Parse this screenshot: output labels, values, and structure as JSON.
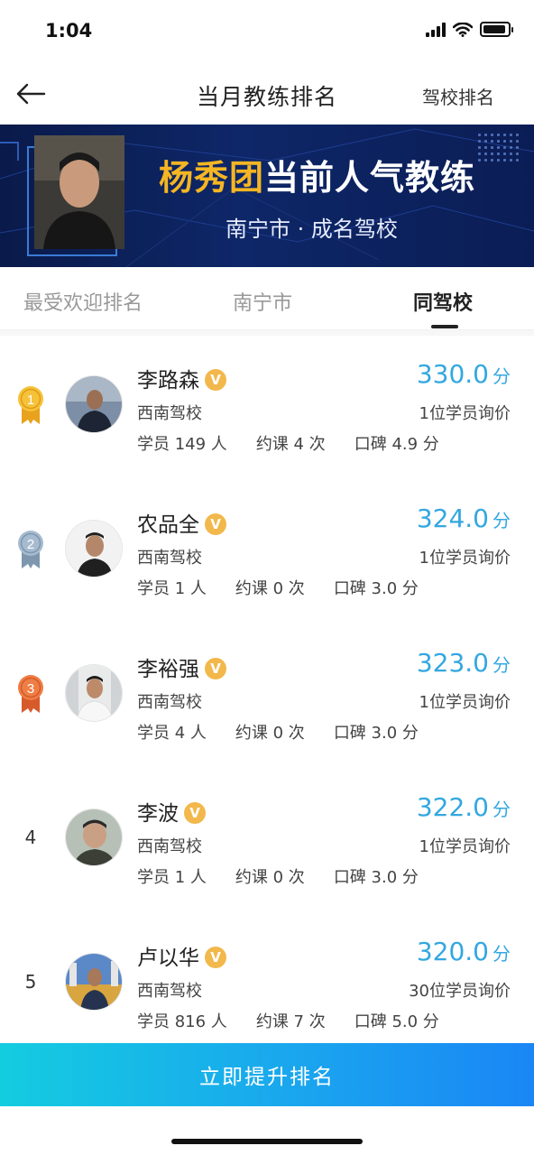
{
  "status": {
    "time": "1:04"
  },
  "nav": {
    "title": "当月教练排名",
    "right_label": "驾校排名",
    "back_icon": "arrow-left-icon"
  },
  "banner": {
    "name": "杨秀团",
    "title_suffix": "当前人气教练",
    "subtitle": "南宁市 · 成名驾校"
  },
  "tabs": [
    {
      "label": "最受欢迎排名",
      "active": false
    },
    {
      "label": "南宁市",
      "active": false
    },
    {
      "label": "同驾校",
      "active": true
    }
  ],
  "coaches": [
    {
      "rank": "1",
      "name": "李路森",
      "school": "西南驾校",
      "score": "330.0",
      "unit": "分",
      "inquiry": "1位学员询价",
      "students": "学员 149 人",
      "lessons": "约课 4 次",
      "rating": "口碑 4.9 分"
    },
    {
      "rank": "2",
      "name": "农品全",
      "school": "西南驾校",
      "score": "324.0",
      "unit": "分",
      "inquiry": "1位学员询价",
      "students": "学员 1 人",
      "lessons": "约课 0 次",
      "rating": "口碑 3.0 分"
    },
    {
      "rank": "3",
      "name": "李裕强",
      "school": "西南驾校",
      "score": "323.0",
      "unit": "分",
      "inquiry": "1位学员询价",
      "students": "学员 4 人",
      "lessons": "约课 0 次",
      "rating": "口碑 3.0 分"
    },
    {
      "rank": "4",
      "name": "李波",
      "school": "西南驾校",
      "score": "322.0",
      "unit": "分",
      "inquiry": "1位学员询价",
      "students": "学员 1 人",
      "lessons": "约课 0 次",
      "rating": "口碑 3.0 分"
    },
    {
      "rank": "5",
      "name": "卢以华",
      "school": "西南驾校",
      "score": "320.0",
      "unit": "分",
      "inquiry": "30位学员询价",
      "students": "学员 816 人",
      "lessons": "约课 7 次",
      "rating": "口碑 5.0 分"
    }
  ],
  "verified_mark": "V",
  "cta": {
    "label": "立即提升排名"
  },
  "colors": {
    "accent_blue": "#33a7e0",
    "banner_highlight": "#f5b623",
    "medal_gold": "#f2b230",
    "medal_silver": "#8fa6bd",
    "medal_bronze": "#e8743b"
  }
}
